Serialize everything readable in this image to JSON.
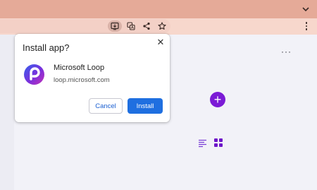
{
  "browser": {
    "chrome_color": "#e5aa98",
    "toolbar_color": "#f7d7cc",
    "icons": [
      "install-app-icon",
      "translate-icon",
      "share-icon",
      "star-icon",
      "chevron-down-icon",
      "kebab-menu-icon"
    ]
  },
  "dialog": {
    "title": "Install app?",
    "close_glyph": "✕",
    "app": {
      "name": "Microsoft Loop",
      "url": "loop.microsoft.com"
    },
    "cancel_label": "Cancel",
    "install_label": "Install",
    "accent": "#1f6fe0"
  },
  "page": {
    "more_glyph": "···",
    "add_glyph": "+",
    "accent": "#7b1bd6"
  }
}
